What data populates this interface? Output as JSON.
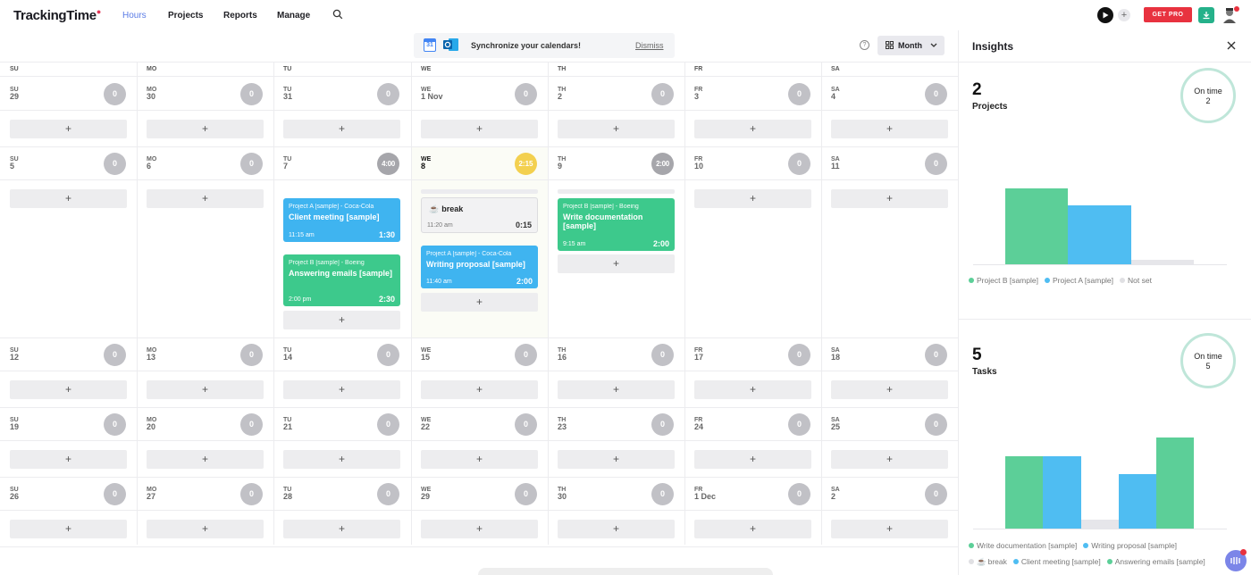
{
  "app": {
    "name": "TrackingTime",
    "logo_mark": "●"
  },
  "nav": {
    "hours": "Hours",
    "projects": "Projects",
    "reports": "Reports",
    "manage": "Manage"
  },
  "header": {
    "get_pro": "GET PRO",
    "plus": "+"
  },
  "banner": {
    "message": "Synchronize your calendars!",
    "dismiss": "Dismiss",
    "gcal_text": "31"
  },
  "toolbar": {
    "help": "?",
    "view": "Month"
  },
  "weekdays": [
    "SU",
    "MO",
    "TU",
    "WE",
    "TH",
    "FR",
    "SA"
  ],
  "add_label": "+",
  "weeks": [
    {
      "days": [
        {
          "dow": "SU",
          "num": "29",
          "count": "0"
        },
        {
          "dow": "MO",
          "num": "30",
          "count": "0"
        },
        {
          "dow": "TU",
          "num": "31",
          "count": "0"
        },
        {
          "dow": "WE",
          "num": "1 Nov",
          "count": "0"
        },
        {
          "dow": "TH",
          "num": "2",
          "count": "0"
        },
        {
          "dow": "FR",
          "num": "3",
          "count": "0"
        },
        {
          "dow": "SA",
          "num": "4",
          "count": "0"
        }
      ]
    },
    {
      "days": [
        {
          "dow": "SU",
          "num": "5",
          "count": "0"
        },
        {
          "dow": "MO",
          "num": "6",
          "count": "0"
        },
        {
          "dow": "TU",
          "num": "7",
          "count": "4:00"
        },
        {
          "dow": "WE",
          "num": "8",
          "count": "2:15"
        },
        {
          "dow": "TH",
          "num": "9",
          "count": "2:00"
        },
        {
          "dow": "FR",
          "num": "10",
          "count": "0"
        },
        {
          "dow": "SA",
          "num": "11",
          "count": "0"
        }
      ]
    },
    {
      "days": [
        {
          "dow": "SU",
          "num": "12",
          "count": "0"
        },
        {
          "dow": "MO",
          "num": "13",
          "count": "0"
        },
        {
          "dow": "TU",
          "num": "14",
          "count": "0"
        },
        {
          "dow": "WE",
          "num": "15",
          "count": "0"
        },
        {
          "dow": "TH",
          "num": "16",
          "count": "0"
        },
        {
          "dow": "FR",
          "num": "17",
          "count": "0"
        },
        {
          "dow": "SA",
          "num": "18",
          "count": "0"
        }
      ]
    },
    {
      "days": [
        {
          "dow": "SU",
          "num": "19",
          "count": "0"
        },
        {
          "dow": "MO",
          "num": "20",
          "count": "0"
        },
        {
          "dow": "TU",
          "num": "21",
          "count": "0"
        },
        {
          "dow": "WE",
          "num": "22",
          "count": "0"
        },
        {
          "dow": "TH",
          "num": "23",
          "count": "0"
        },
        {
          "dow": "FR",
          "num": "24",
          "count": "0"
        },
        {
          "dow": "SA",
          "num": "25",
          "count": "0"
        }
      ]
    },
    {
      "days": [
        {
          "dow": "SU",
          "num": "26",
          "count": "0"
        },
        {
          "dow": "MO",
          "num": "27",
          "count": "0"
        },
        {
          "dow": "TU",
          "num": "28",
          "count": "0"
        },
        {
          "dow": "WE",
          "num": "29",
          "count": "0"
        },
        {
          "dow": "TH",
          "num": "30",
          "count": "0"
        },
        {
          "dow": "FR",
          "num": "1 Dec",
          "count": "0"
        },
        {
          "dow": "SA",
          "num": "2",
          "count": "0"
        }
      ]
    }
  ],
  "entries": {
    "tu7_a": {
      "project": "Project A [sample] - Coca-Cola",
      "task": "Client meeting [sample]",
      "time": "11:15 am",
      "duration": "1:30"
    },
    "tu7_b": {
      "project": "Project B [sample] - Boeing",
      "task": "Answering emails [sample]",
      "time": "2:00 pm",
      "duration": "2:30"
    },
    "we8_break": {
      "task": "break",
      "icon": "☕",
      "time": "11:20 am",
      "duration": "0:15"
    },
    "we8_a": {
      "project": "Project A [sample] - Coca-Cola",
      "task": "Writing proposal [sample]",
      "time": "11:40 am",
      "duration": "2:00"
    },
    "th9_b": {
      "project": "Project B [sample] - Boeing",
      "task": "Write documentation [sample]",
      "time": "9:15 am",
      "duration": "2:00"
    }
  },
  "insights": {
    "title": "Insights",
    "projects": {
      "count": "2",
      "label": "Projects",
      "ring_label": "On time",
      "ring_value": "2"
    },
    "tasks": {
      "count": "5",
      "label": "Tasks",
      "ring_label": "On time",
      "ring_value": "5"
    },
    "project_legend": [
      {
        "label": "Project B [sample]",
        "color": "#5ccf98"
      },
      {
        "label": "Project A [sample]",
        "color": "#4fbdf2"
      },
      {
        "label": "Not set",
        "color": "#e0e0e3"
      }
    ],
    "task_legend_row1": [
      {
        "label": "Write documentation [sample]",
        "color": "#5ccf98"
      },
      {
        "label": "Writing proposal [sample]",
        "color": "#4fbdf2"
      }
    ],
    "task_legend_row2": [
      {
        "label": "break",
        "color": "#e0e0e3",
        "icon": "☕"
      },
      {
        "label": "Client meeting [sample]",
        "color": "#4fbdf2"
      },
      {
        "label": "Answering emails [sample]",
        "color": "#5ccf98"
      }
    ]
  },
  "chart_data": [
    {
      "type": "bar",
      "categories": [
        "Project B [sample]",
        "Project A [sample]",
        "Not set"
      ],
      "values": [
        4.5,
        3.5,
        0.25
      ],
      "colors": [
        "#5ccf98",
        "#4fbdf2",
        "#e6e6ea"
      ],
      "ylim": [
        0,
        5
      ],
      "legend": "bottom",
      "grid": false
    },
    {
      "type": "bar",
      "categories": [
        "Write documentation [sample]",
        "Writing proposal [sample]",
        "break",
        "Client meeting [sample]",
        "Answering emails [sample]"
      ],
      "values": [
        2.0,
        2.0,
        0.25,
        1.5,
        2.5
      ],
      "colors": [
        "#5ccf98",
        "#4fbdf2",
        "#e6e6ea",
        "#4fbdf2",
        "#5ccf98"
      ],
      "ylim": [
        0,
        3
      ],
      "legend": "bottom",
      "grid": false
    }
  ]
}
